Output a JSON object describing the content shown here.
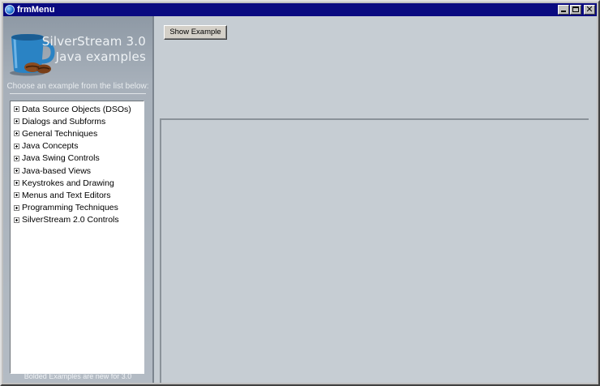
{
  "window": {
    "title": "frmMenu",
    "controls": [
      "minimize-icon",
      "maximize-icon",
      "close-icon"
    ]
  },
  "sidebar": {
    "brand_line1": "SilverStream 3.0",
    "brand_line2": "Java examples",
    "instruction": "Choose an example from the list below:",
    "tree_items": [
      {
        "label": "Data Source Objects (DSOs)"
      },
      {
        "label": "Dialogs and Subforms"
      },
      {
        "label": "General Techniques"
      },
      {
        "label": "Java Concepts"
      },
      {
        "label": "Java Swing Controls"
      },
      {
        "label": "Java-based Views"
      },
      {
        "label": "Keystrokes and Drawing"
      },
      {
        "label": "Menus and Text Editors"
      },
      {
        "label": "Programming Techniques"
      },
      {
        "label": "SilverStream 2.0 Controls"
      }
    ],
    "footer_note": "Bolded Examples are new for 3.0"
  },
  "main": {
    "show_example_label": "Show Example"
  },
  "colors": {
    "titlebar": "#0a0a80",
    "sidebar": "#a7b0ba",
    "content_bg": "#c6cdd3"
  }
}
